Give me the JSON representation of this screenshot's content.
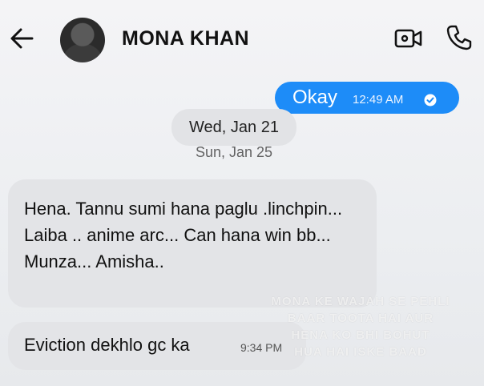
{
  "header": {
    "contact_name": "MONA KHAN",
    "back_icon": "arrow-left-icon",
    "video_icon": "video-call-icon",
    "call_icon": "phone-icon"
  },
  "messages": {
    "outgoing": {
      "text": "Okay",
      "time": "12:49 AM",
      "status_icon": "check-circle-icon"
    },
    "date_separator": "Wed, Jan 21",
    "date_separator_ghost": "Sun, Jan 25",
    "incoming_1": {
      "text": "Hena. Tannu sumi hana paglu .linchpin... Laiba .. anime arc... Can hana win bb... Munza... Amisha.."
    },
    "incoming_2": {
      "text": "Eviction dekhlo gc ka",
      "time": "9:34 PM"
    }
  },
  "overlay": {
    "lines": [
      "MONA KE WAJAH SE PEHLI",
      "BAAR TOOTA HAI AUR",
      "HENA KO BHI BOHUT",
      "HUA HAI ISKE BAAD"
    ]
  },
  "colors": {
    "outgoing_bubble": "#1d8cf8",
    "incoming_bubble": "#e3e4e7"
  }
}
